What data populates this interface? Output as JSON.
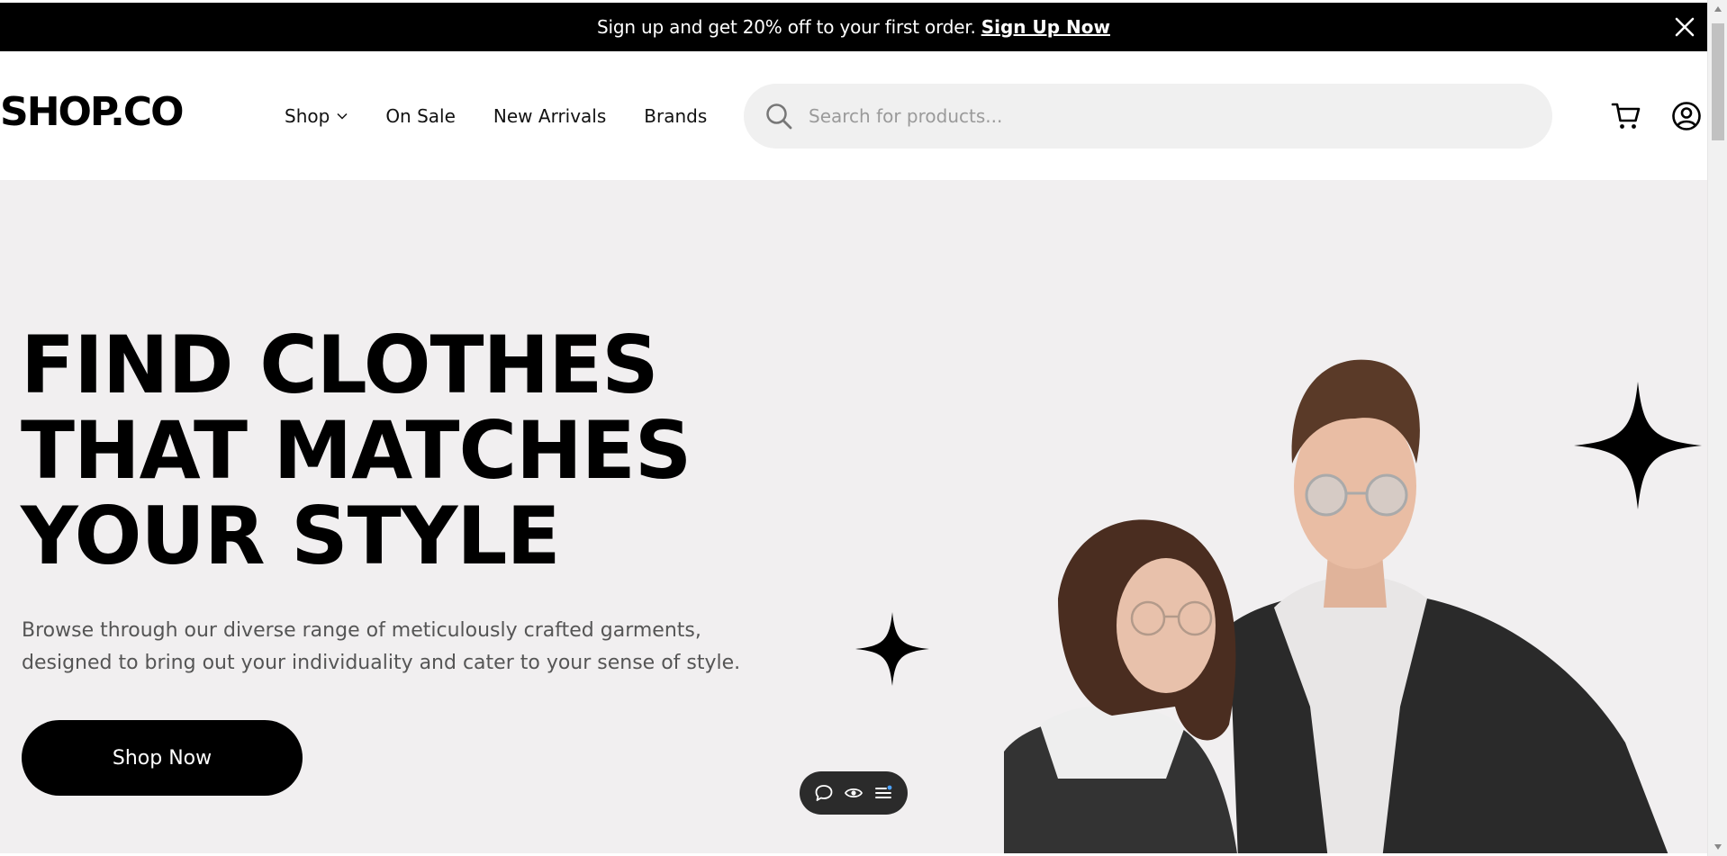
{
  "announcement": {
    "message": "Sign up and get 20% off to your first order.",
    "link_label": "Sign Up Now"
  },
  "header": {
    "logo": "SHOP.CO",
    "nav": [
      {
        "label": "Shop",
        "has_dropdown": true
      },
      {
        "label": "On Sale"
      },
      {
        "label": "New Arrivals"
      },
      {
        "label": "Brands"
      }
    ],
    "search": {
      "placeholder": "Search for products...",
      "value": ""
    }
  },
  "hero": {
    "title_lines": [
      "FIND CLOTHES",
      "THAT MATCHES",
      "YOUR STYLE"
    ],
    "description": "Browse through our diverse range of meticulously crafted garments, designed to bring out your individuality and cater to your sense of style.",
    "cta_label": "Shop Now"
  },
  "icons": {
    "close": "close-icon",
    "search": "search-icon",
    "cart": "cart-icon",
    "user": "user-circle-icon",
    "chevron": "chevron-down-icon",
    "sparkle": "sparkle-star-icon",
    "toolbar": [
      "comment-icon",
      "eye-icon",
      "menu-list-icon"
    ]
  },
  "colors": {
    "announcement_bg": "#000000",
    "hero_bg": "#f1eff0",
    "search_bg": "#f0f0f0",
    "text_muted": "#555555",
    "cta_bg": "#000000"
  }
}
